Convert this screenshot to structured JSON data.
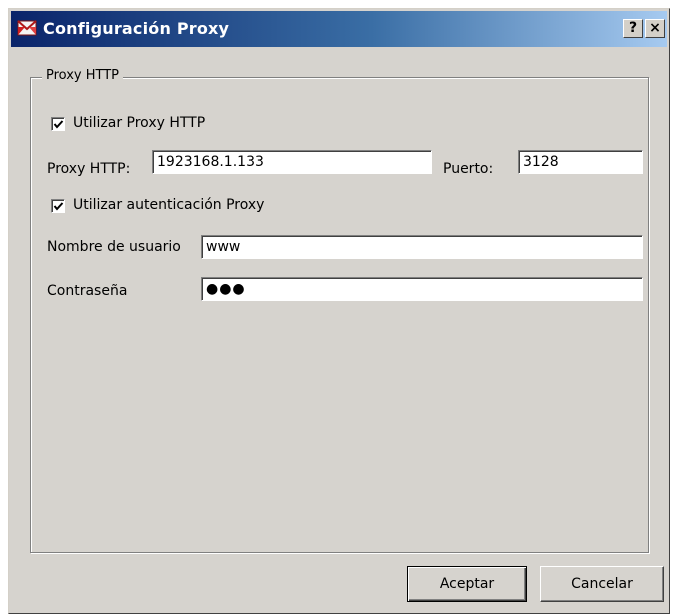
{
  "window": {
    "title": "Configuración Proxy",
    "help_label": "?",
    "close_label": "×"
  },
  "group": {
    "legend": "Proxy HTTP"
  },
  "use_proxy": {
    "label": "Utilizar Proxy HTTP",
    "checked": true
  },
  "proxy": {
    "label": "Proxy HTTP:",
    "value": "1923168.1.133",
    "port_label": "Puerto:",
    "port_value": "3128"
  },
  "use_auth": {
    "label": "Utilizar autenticación Proxy",
    "checked": true
  },
  "username": {
    "label": "Nombre de usuario",
    "value": "www"
  },
  "password": {
    "label": "Contraseña",
    "masked_value": "●●●"
  },
  "buttons": {
    "accept": "Aceptar",
    "cancel": "Cancelar"
  },
  "icons": {
    "app": "envelope-icon",
    "check": "checkmark-icon"
  },
  "colors": {
    "title_start": "#0a246a",
    "title_end": "#a6caf0",
    "dialog_bg": "#d6d3ce"
  }
}
